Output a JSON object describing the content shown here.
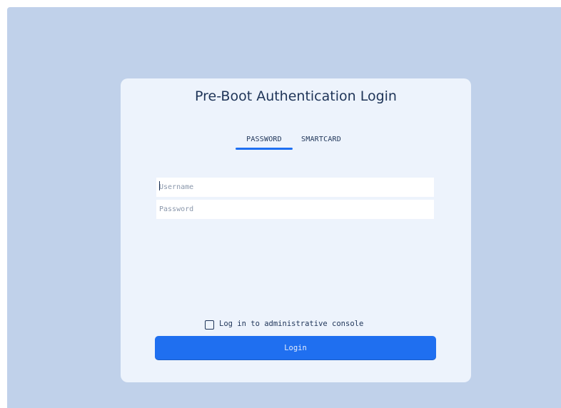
{
  "colors": {
    "background": "#c0d1ea",
    "card": "#edf3fc",
    "accent": "#1e6ff2",
    "text": "#1e3458",
    "placeholder": "#8a97ab"
  },
  "login": {
    "title": "Pre-Boot Authentication Login",
    "tabs": [
      {
        "label": "PASSWORD",
        "active": true
      },
      {
        "label": "SMARTCARD",
        "active": false
      }
    ],
    "username": {
      "placeholder": "Username",
      "value": ""
    },
    "password": {
      "placeholder": "Password",
      "value": ""
    },
    "admin_console": {
      "label": "Log in to administrative console",
      "checked": false
    },
    "submit_label": "Login"
  }
}
